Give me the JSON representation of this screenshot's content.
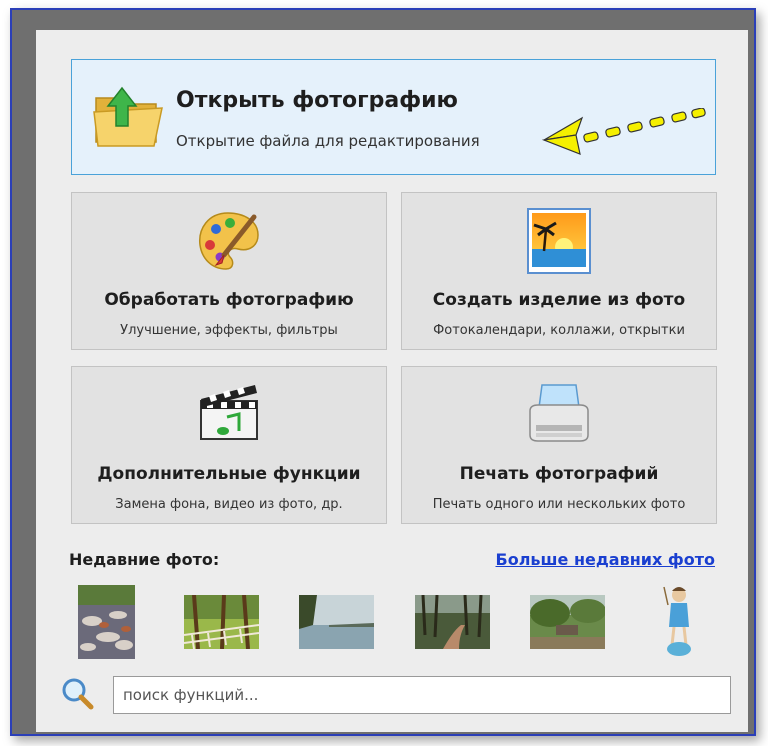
{
  "hero": {
    "title": "Открыть фотографию",
    "subtitle": "Открытие файла для редактирования",
    "icon": "folder-open-icon"
  },
  "tiles": [
    {
      "title": "Обработать фотографию",
      "subtitle": "Улучшение, эффекты, фильтры",
      "icon": "palette-icon"
    },
    {
      "title": "Создать изделие из фото",
      "subtitle": "Фотокалендари, коллажи, открытки",
      "icon": "sunset-photo-icon"
    },
    {
      "title": "Дополнительные функции",
      "subtitle": "Замена фона, видео из фото, др.",
      "icon": "clapperboard-icon"
    },
    {
      "title": "Печать фотографий",
      "subtitle": "Печать одного или нескольких фото",
      "icon": "printer-icon"
    }
  ],
  "recent": {
    "label": "Недавние фото:",
    "more_link": "Больше недавних фото",
    "thumbnails": [
      "autumn-leaves-photo",
      "forest-fence-photo",
      "lake-photo",
      "forest-path-photo",
      "park-bench-photo",
      "figurine-photo"
    ]
  },
  "search": {
    "placeholder": "поиск функций..."
  },
  "colors": {
    "frame_border": "#2b3fb8",
    "hero_border": "#4aa2d9",
    "hero_bg": "#e5f1fb",
    "tile_bg": "#e2e2e2",
    "link": "#1a3fd0",
    "annotation_arrow": "#f5f000"
  }
}
